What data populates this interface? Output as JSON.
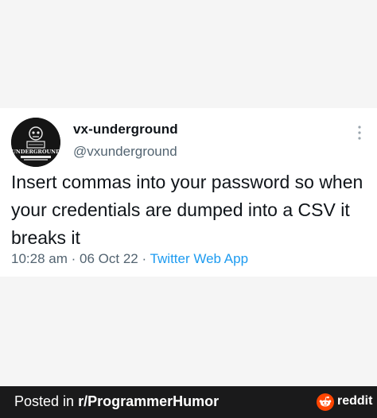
{
  "tweet": {
    "display_name": "vx-underground",
    "handle": "@vxunderground",
    "text": "Insert commas into your password so when your credentials are dumped into a CSV it breaks it",
    "time": "10:28 am",
    "separator": "·",
    "date": "06 Oct 22",
    "source": "Twitter Web App",
    "avatar_text": "UNDERGROUND",
    "more_icon": "ellipsis-vertical-icon"
  },
  "footer": {
    "posted_prefix": "Posted in ",
    "subreddit": "r/ProgrammerHumor",
    "brand": "reddit",
    "brand_color": "#ff4500"
  },
  "colors": {
    "tweet_bg": "#ffffff",
    "page_bg": "#f5f5f5",
    "footer_bg": "#1a1a1b",
    "text_primary": "#0f1419",
    "text_secondary": "#536471",
    "link": "#1d9bf0"
  }
}
